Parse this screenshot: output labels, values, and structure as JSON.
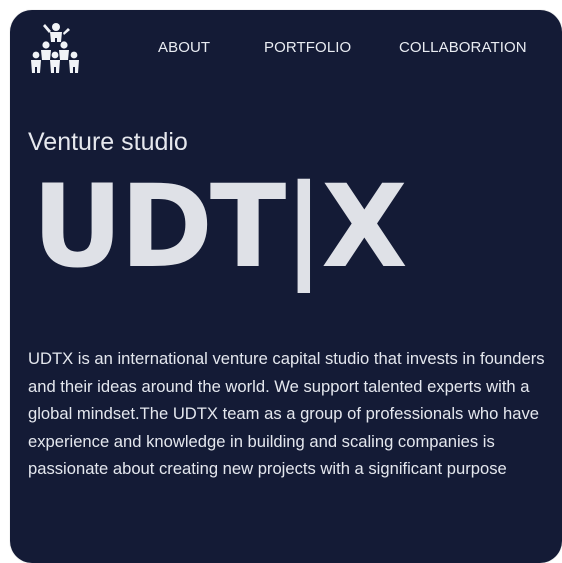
{
  "header": {
    "logo_icon": "team-pyramid-icon",
    "nav": [
      {
        "label": "ABOUT"
      },
      {
        "label": "PORTFOLIO"
      },
      {
        "label": "COLLABORATION"
      }
    ]
  },
  "hero": {
    "subtitle": "Venture studio",
    "brand": "UDT|X",
    "description": "UDTX is an international venture capital studio that invests in founders and their ideas around the world. We support talented experts with a global mindset.The UDTX team as a group of professionals who have experience and knowledge in building and scaling companies is passionate about creating new projects with a significant purpose"
  },
  "colors": {
    "background": "#141b36",
    "text": "#e4e7ee",
    "page": "#ffffff"
  }
}
